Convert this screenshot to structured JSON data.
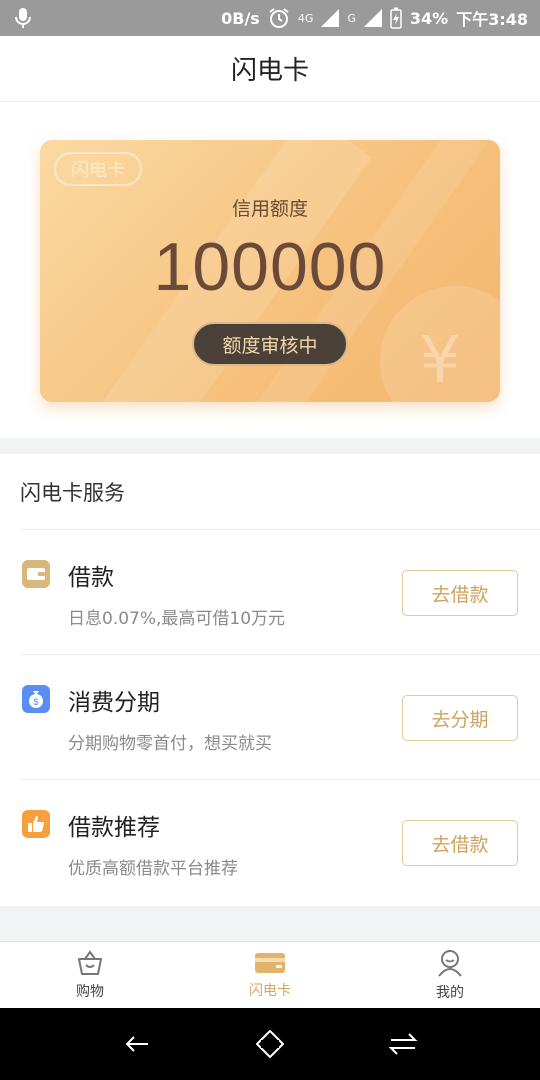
{
  "status_bar": {
    "speed": "0B/s",
    "network_4g": "4G",
    "network_g": "G",
    "battery": "34%",
    "time": "下午3:48"
  },
  "header": {
    "title": "闪电卡"
  },
  "card": {
    "logo_text": "闪电卡",
    "credit_label": "信用额度",
    "credit_value": "100000",
    "status_button": "额度审核中",
    "coin_symbol": "¥"
  },
  "services": {
    "title": "闪电卡服务",
    "items": [
      {
        "icon": "wallet-icon",
        "icon_color": "#d9b77a",
        "title": "借款",
        "desc": "日息0.07%,最高可借10万元",
        "button": "去借款"
      },
      {
        "icon": "money-bag-icon",
        "icon_color": "#5b8ef0",
        "title": "消费分期",
        "desc": "分期购物零首付，想买就买",
        "button": "去分期"
      },
      {
        "icon": "thumbs-up-icon",
        "icon_color": "#f5a03c",
        "title": "借款推荐",
        "desc": "优质高额借款平台推荐",
        "button": "去借款"
      }
    ]
  },
  "tabbar": {
    "tabs": [
      {
        "label": "购物",
        "icon": "basket-icon",
        "active": false
      },
      {
        "label": "闪电卡",
        "icon": "card-icon",
        "active": true
      },
      {
        "label": "我的",
        "icon": "user-icon",
        "active": false
      }
    ]
  },
  "colors": {
    "accent": "#d9a55a",
    "card_start": "#fbd9a3",
    "card_end": "#f3b66c"
  }
}
